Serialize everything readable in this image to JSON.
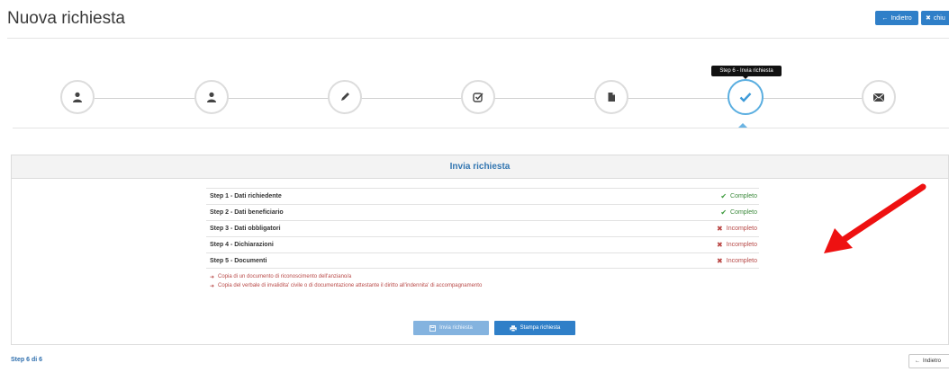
{
  "header": {
    "title": "Nuova richiesta",
    "back_label": "Indietro",
    "close_label": "chiu"
  },
  "stepper": {
    "tooltip": "Step 6 - Invia richiesta",
    "steps": [
      {
        "icon": "user-icon"
      },
      {
        "icon": "user-icon"
      },
      {
        "icon": "pencil-icon"
      },
      {
        "icon": "checkbox-icon"
      },
      {
        "icon": "document-icon"
      },
      {
        "icon": "check-icon",
        "active": true
      },
      {
        "icon": "envelope-icon"
      }
    ]
  },
  "panel": {
    "title": "Invia richiesta",
    "rows": [
      {
        "label": "Step 1 - Dati richiedente",
        "status": "Completo"
      },
      {
        "label": "Step 2 - Dati beneficiario",
        "status": "Completo"
      },
      {
        "label": "Step 3 - Dati obbligatori",
        "status": "Incompleto"
      },
      {
        "label": "Step 4 - Dichiarazioni",
        "status": "Incompleto"
      },
      {
        "label": "Step 5 - Documenti",
        "status": "Incompleto"
      }
    ],
    "missing_docs": [
      "Copia di un documento di riconoscimento dell'anziano/a",
      "Copia del verbale di invalidita' civile o di documentazione attestante il diritto all'indennita' di accompagnamento"
    ],
    "send_label": "Invia richiesta",
    "print_label": "Stampa richiesta"
  },
  "footer": {
    "step_count": "Step 6 di 6",
    "back_label": "Indietro"
  },
  "colors": {
    "primary": "#2f7fc8",
    "ok": "#3c8a3c",
    "error": "#b94a48",
    "annotation_arrow": "#ee1111"
  }
}
